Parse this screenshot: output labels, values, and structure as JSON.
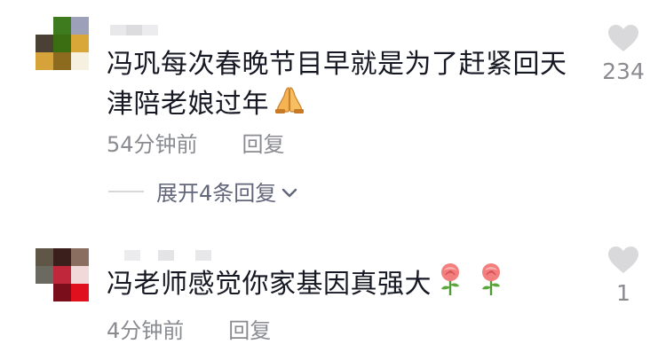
{
  "comments": [
    {
      "text": "冯巩每次春晚节目早就是为了赶紧回天津陪老娘过年",
      "emoji": "folded-hands-emoji",
      "time": "54分钟前",
      "reply_label": "回复",
      "expand_label": "展开4条回复",
      "like_count": "234",
      "avatar_colors": [
        "#ffffff",
        "#3e7a1e",
        "#9ca0b8",
        "#4a4034",
        "#3b6e12",
        "#d9a738",
        "#d6a23a",
        "#8c6a1e",
        "#ffffff"
      ]
    },
    {
      "text": "冯老师感觉你家基因真强大",
      "emoji": "rose-emoji",
      "time": "4分钟前",
      "reply_label": "回复",
      "like_count": "1",
      "avatar_colors": [
        "#5f5647",
        "#3a1f1c",
        "#8a6e60",
        "#6b6a60",
        "#c1273a",
        "#f2d9d9",
        "#ffffff",
        "#7a0f1b",
        "#e0101e"
      ]
    }
  ],
  "colors": {
    "text": "#161823",
    "meta": "#8a8b91",
    "expand": "#61667a",
    "heart": "#d9d9dc"
  }
}
